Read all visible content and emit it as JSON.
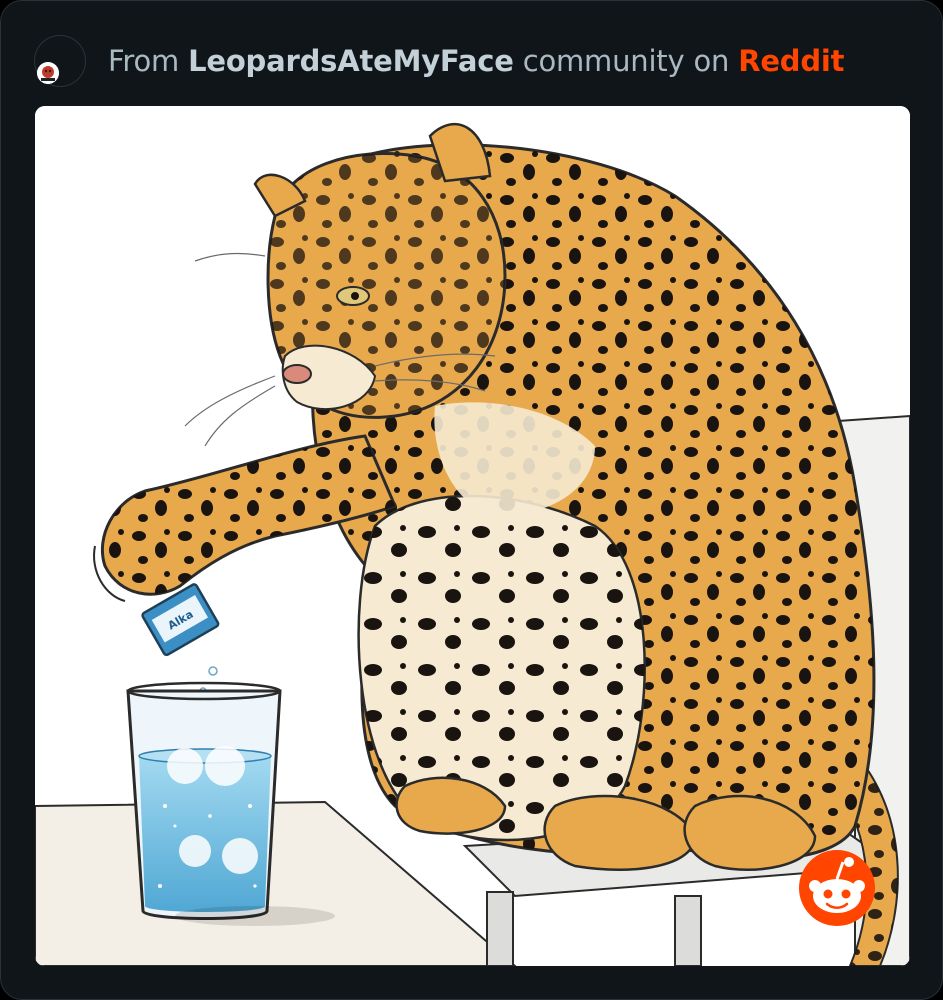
{
  "header": {
    "prefix": "From ",
    "community": "LeopardsAteMyFace",
    "middle": " community on ",
    "brand": "Reddit"
  },
  "icons": {
    "avatar": "community-avatar-icon",
    "badge": "reddit-snoo-icon"
  },
  "colors": {
    "background": "#0f1519",
    "header_text": "#a9b8c1",
    "brand": "#ff4500"
  }
}
